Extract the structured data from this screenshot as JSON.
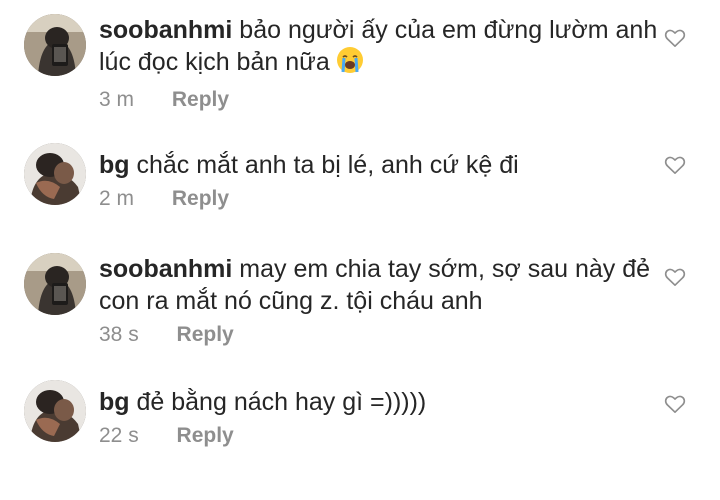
{
  "comments": [
    {
      "username": "soobanhmi",
      "text": "bảo người ấy của em đừng lườm anh lúc đọc kịch bản nữa",
      "emoji": "loudly-crying-face",
      "time": "3 m",
      "reply": "Reply",
      "avatar": "soobanhmi-avatar"
    },
    {
      "username": "bg",
      "text": "chắc mắt anh ta bị lé, anh cứ kệ đi",
      "time": "2 m",
      "reply": "Reply",
      "avatar": "bg-avatar"
    },
    {
      "username": "soobanhmi",
      "text": "may em chia tay sớm, sợ sau này đẻ con ra mắt nó cũng z. tội cháu anh",
      "time": "38 s",
      "reply": "Reply",
      "avatar": "soobanhmi-avatar"
    },
    {
      "username": "bg",
      "text": "đẻ bằng nách hay gì =)))))",
      "time": "22 s",
      "reply": "Reply",
      "avatar": "bg-avatar"
    }
  ],
  "colors": {
    "text": "#262626",
    "meta": "#8e8e8e",
    "heart": "#8e8e8e",
    "background": "#ffffff"
  },
  "icons": {
    "like": "heart-outline-icon"
  }
}
